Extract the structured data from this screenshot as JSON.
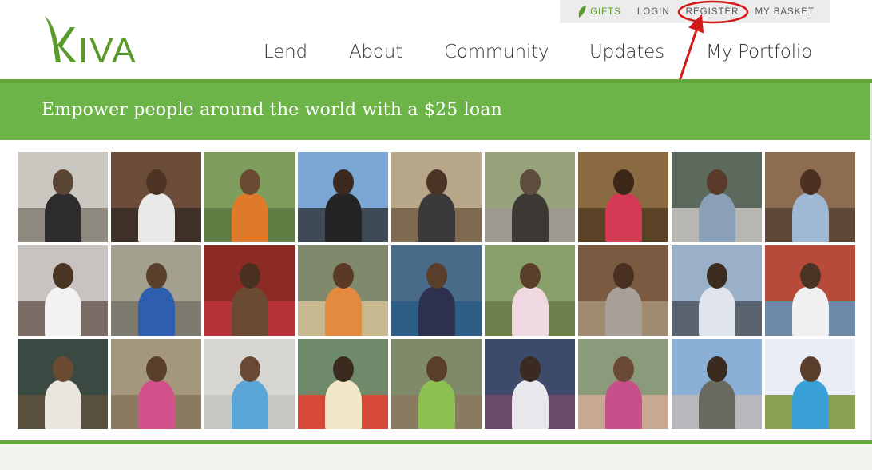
{
  "utility": {
    "gifts": "GIFTS",
    "login": "LOGIN",
    "register": "REGISTER",
    "basket": "MY BASKET"
  },
  "logo": {
    "text": "KIVA"
  },
  "nav": {
    "lend": "Lend",
    "about": "About",
    "community": "Community",
    "updates": "Updates",
    "portfolio": "My Portfolio"
  },
  "banner": {
    "tagline": "Empower people around the world with a $25 loan"
  },
  "colors": {
    "brand_green": "#6cb447",
    "annotation_red": "#d41919"
  },
  "photos": [
    {
      "bg": "#c9c7c0",
      "ground": "#8e8a80",
      "head": "#5b4535",
      "body": "#2d2d2d"
    },
    {
      "bg": "#6b4d3a",
      "ground": "#3e3027",
      "head": "#4e3424",
      "body": "#e8e8e8"
    },
    {
      "bg": "#7e9c5c",
      "ground": "#5f7d43",
      "head": "#6b4a33",
      "body": "#e07a2b"
    },
    {
      "bg": "#7aa6d6",
      "ground": "#3e4a55",
      "head": "#3a2a20",
      "body": "#242424"
    },
    {
      "bg": "#b9a78a",
      "ground": "#7d6a50",
      "head": "#4c3526",
      "body": "#3a3a3a"
    },
    {
      "bg": "#98a37c",
      "ground": "#9c9a90",
      "head": "#5e4c3c",
      "body": "#3d3a35"
    },
    {
      "bg": "#8a6a40",
      "ground": "#5a4226",
      "head": "#3c2618",
      "body": "#d43a54"
    },
    {
      "bg": "#5c6a5e",
      "ground": "#b7b6b0",
      "head": "#5a3a2a",
      "body": "#8aa0b8"
    },
    {
      "bg": "#8c6d52",
      "ground": "#5e4838",
      "head": "#4a3020",
      "body": "#9fb8d4"
    },
    {
      "bg": "#c8c2c0",
      "ground": "#7c6c66",
      "head": "#4a3424",
      "body": "#f2f2f2"
    },
    {
      "bg": "#a3a08f",
      "ground": "#7d7a70",
      "head": "#5a3e2c",
      "body": "#2e5fae"
    },
    {
      "bg": "#8c2a24",
      "ground": "#b8323a",
      "head": "#4a3020",
      "body": "#6a4a30"
    },
    {
      "bg": "#7f8a6c",
      "ground": "#c8b890",
      "head": "#5a3a26",
      "body": "#e48a40"
    },
    {
      "bg": "#4a6a8a",
      "ground": "#2e5d86",
      "head": "#5a3e2c",
      "body": "#2e3050"
    },
    {
      "bg": "#8aa06a",
      "ground": "#6e7f4c",
      "head": "#5a3e2c",
      "body": "#f0d8e0"
    },
    {
      "bg": "#7a5a40",
      "ground": "#a08a70",
      "head": "#4a3020",
      "body": "#a8a098"
    },
    {
      "bg": "#9ab0c8",
      "ground": "#5a6470",
      "head": "#3c2c20",
      "body": "#e0e4ec"
    },
    {
      "bg": "#b84a3a",
      "ground": "#6c8aa8",
      "head": "#4a3424",
      "body": "#f0f0f0"
    },
    {
      "bg": "#3a4a42",
      "ground": "#5a5040",
      "head": "#6a4a30",
      "body": "#eae6dc"
    },
    {
      "bg": "#a4987c",
      "ground": "#8c7a60",
      "head": "#5a3e2c",
      "body": "#d4508a"
    },
    {
      "bg": "#d8d6d2",
      "ground": "#c8c6c0",
      "head": "#6a4a34",
      "body": "#5aa6d8"
    },
    {
      "bg": "#6e8a6a",
      "ground": "#d84a38",
      "head": "#3a2a20",
      "body": "#f2e8c8"
    },
    {
      "bg": "#7e8a6a",
      "ground": "#8a7a60",
      "head": "#5a3e2c",
      "body": "#8cc050"
    },
    {
      "bg": "#3e4a6a",
      "ground": "#6a4a6a",
      "head": "#3a2a20",
      "body": "#e8e8ec"
    },
    {
      "bg": "#8a9a7a",
      "ground": "#c8a890",
      "head": "#6a4a34",
      "body": "#c8508a"
    },
    {
      "bg": "#8ab0d8",
      "ground": "#b8b8bc",
      "head": "#3a2a20",
      "body": "#6a6a60"
    },
    {
      "bg": "#eaeef4",
      "ground": "#8aa050",
      "head": "#5a3e2c",
      "body": "#3aa0d8"
    }
  ]
}
